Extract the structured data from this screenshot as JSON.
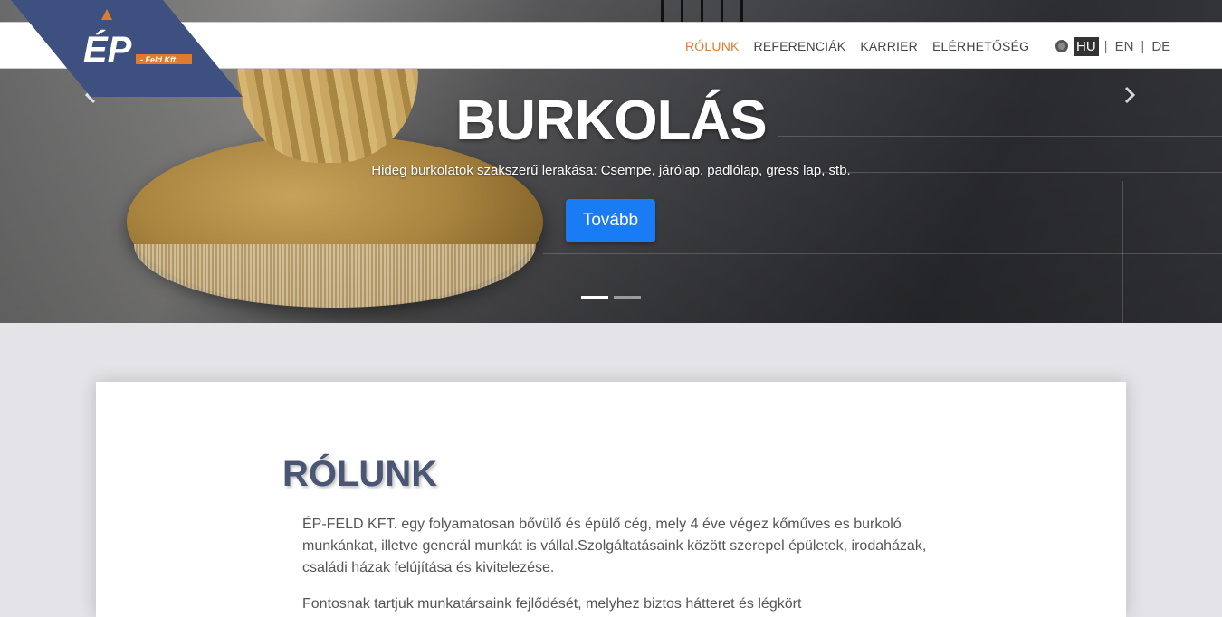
{
  "nav": {
    "items": [
      {
        "label": "RÓLUNK",
        "active": true
      },
      {
        "label": "REFERENCIÁK",
        "active": false
      },
      {
        "label": "KARRIER",
        "active": false
      },
      {
        "label": "ELÉRHETŐSÉG",
        "active": false
      }
    ],
    "languages": [
      "HU",
      "EN",
      "DE"
    ],
    "current_language": "HU"
  },
  "logo": {
    "text": "ÉP",
    "subtext": "- Feld Kft.",
    "colors": {
      "banner": "#3d5080",
      "accent": "#e07b2e"
    }
  },
  "hero": {
    "title": "BURKOLÁS",
    "subtitle": "Hideg burkolatok szakszerű lerakása: Csempe, járólap, padlólap, gress lap, stb.",
    "button_label": "Tovább",
    "slide_count": 2,
    "active_slide": 1,
    "prev_icon": "chevron-left-icon",
    "next_icon": "chevron-right-icon"
  },
  "about": {
    "title": "RÓLUNK",
    "paragraph1": "ÉP-FELD KFT. egy folyamatosan bővülő és épülő cég, mely 4 éve végez kőműves es burkoló munkánkat, illetve generál munkát is vállal.Szolgáltatásaink között szerepel épületek, irodaházak, családi házak felújítása és kivitelezése.",
    "paragraph2": "Fontosnak tartjuk munkatársaink fejlődését, melyhez biztos hátteret és légkört"
  },
  "colors": {
    "accent": "#e07b2e",
    "button": "#1a7cf5",
    "heading": "#4a5673",
    "page_bg": "#e4e3e8"
  }
}
